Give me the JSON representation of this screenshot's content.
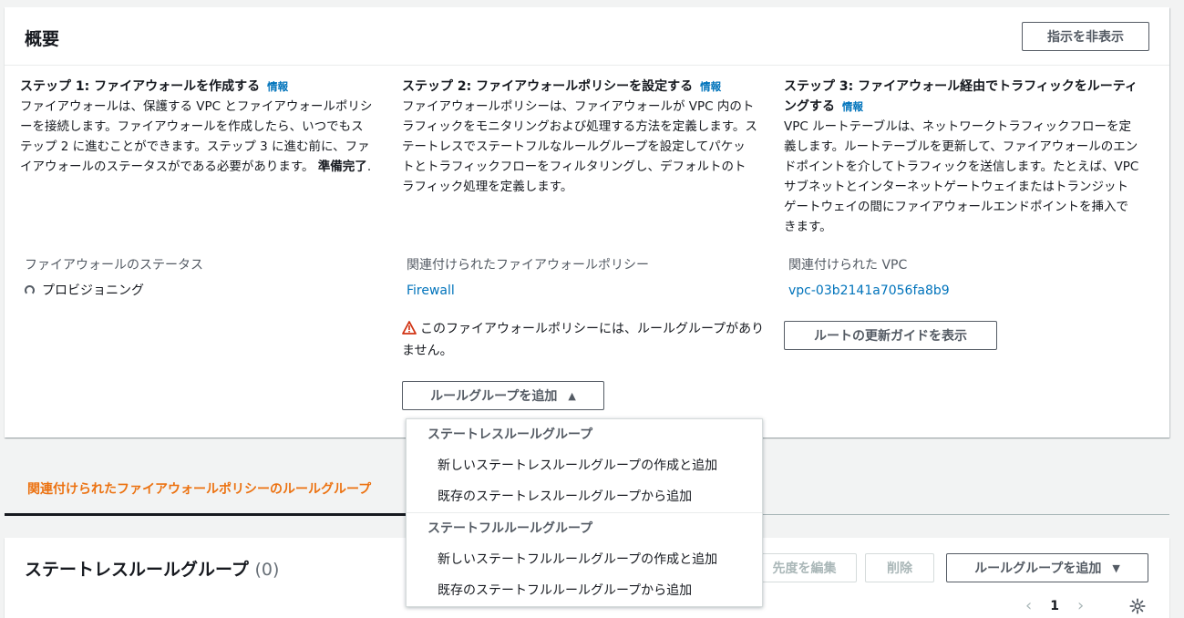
{
  "overview": {
    "title": "概要",
    "hide_instructions_label": "指示を非表示"
  },
  "steps": [
    {
      "title": "ステップ 1: ファイアウォールを作成する",
      "info": "情報",
      "description": "ファイアウォールは、保護する VPC とファイアウォールポリシーを接続します。ファイアウォールを作成したら、いつでもステップ 2 に進むことができます。ステップ 3 に進む前に、ファイアウォールのステータスがである必要があります。",
      "description_bold": "準備完了",
      "description_tail": "."
    },
    {
      "title": "ステップ 2: ファイアウォールポリシーを設定する",
      "info": "情報",
      "description": "ファイアウォールポリシーは、ファイアウォールが VPC 内のトラフィックをモニタリングおよび処理する方法を定義します。ステートレスでステートフルなルールグループを設定してパケットとトラフィックフローをフィルタリングし、デフォルトのトラフィック処理を定義します。"
    },
    {
      "title": "ステップ 3: ファイアウォール経由でトラフィックをルーティングする",
      "info": "情報",
      "description": "VPC ルートテーブルは、ネットワークトラフィックフローを定義します。ルートテーブルを更新して、ファイアウォールのエンドポイントを介してトラフィックを送信します。たとえば、VPC サブネットとインターネットゲートウェイまたはトランジットゲートウェイの間にファイアウォールエンドポイントを挿入できます。"
    }
  ],
  "status": {
    "label": "ファイアウォールのステータス",
    "value": "プロビジョニング"
  },
  "policy": {
    "label": "関連付けられたファイアウォールポリシー",
    "value": "Firewall",
    "warning": "このファイアウォールポリシーには、ルールグループがありません。",
    "add_rule_group_label": "ルールグループを追加",
    "caret": "▲"
  },
  "vpc": {
    "label": "関連付けられた VPC",
    "value": "vpc-03b2141a7056fa8b9",
    "route_guide_label": "ルートの更新ガイドを表示"
  },
  "dropdown": {
    "groups": [
      {
        "label": "ステートレスルールグループ",
        "items": [
          "新しいステートレスルールグループの作成と追加",
          "既存のステートレスルールグループから追加"
        ]
      },
      {
        "label": "ステートフルルールグループ",
        "items": [
          "新しいステートフルルールグループの作成と追加",
          "既存のステートフルルールグループから追加"
        ]
      }
    ]
  },
  "tab": {
    "label": "関連付けられたファイアウォールポリシーのルールグループ"
  },
  "stateless": {
    "title": "ステートレスルールグループ",
    "count": "(0)",
    "edit_priority_label": "先度を編集",
    "delete_label": "削除",
    "add_label": "ルールグループを追加",
    "caret": "▼",
    "page": "1"
  },
  "colors": {
    "link": "#0073bb",
    "tab_active": "#ec7211",
    "warning": "#d13212"
  }
}
